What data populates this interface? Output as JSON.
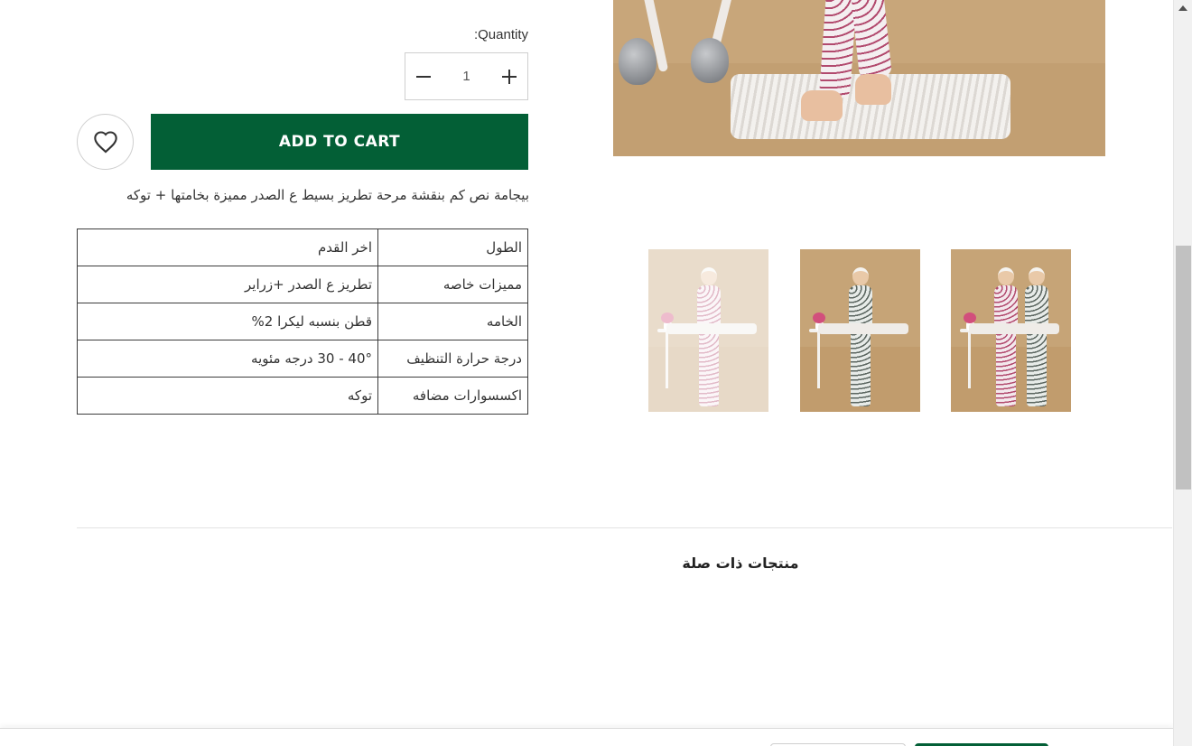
{
  "product": {
    "quantity_label": ":Quantity",
    "quantity_value": "1",
    "add_to_cart_label": "ADD TO CART",
    "description": "بيجامة نص كم  بنقشة مرحة  تطريز بسيط ع الصدر مميزة بخامتها + توكه",
    "specs": [
      {
        "key": "الطول",
        "value": "اخر القدم"
      },
      {
        "key": "مميزات خاصه",
        "value": "تطريز  ع الصدر +زراير"
      },
      {
        "key": "الخامه",
        "value": "قطن بنسبه ليكرا 2%"
      },
      {
        "key": "درجة حرارة التنظيف",
        "value": "40° - 30 درجه مئويه"
      },
      {
        "key": "اكسسوارات مضافه",
        "value": "توكه"
      }
    ]
  },
  "gallery": {
    "thumbnails": [
      "pajama-single-pink",
      "pajama-single-gray",
      "pajama-duo"
    ]
  },
  "related": {
    "title": "منتجات ذات صلة"
  },
  "colors": {
    "brand_green": "#035f36",
    "border": "#cfcfcf",
    "text": "#333333"
  },
  "icons": {
    "wishlist": "heart-icon",
    "decrement": "minus-icon",
    "increment": "plus-icon"
  }
}
